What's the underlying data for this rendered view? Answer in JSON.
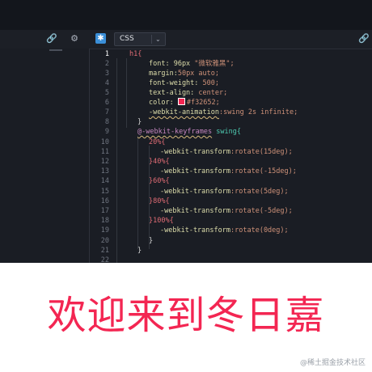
{
  "toolbar": {
    "link_icon": "link-icon",
    "settings_icon": "gear-icon",
    "app_icon": "snowflake-icon",
    "language": "CSS",
    "dropdown_icon": "chevron-down-icon",
    "right_icon": "link-icon",
    "app_glyph": "✱",
    "link_glyph": "🔗",
    "gear_glyph": "⚙",
    "chevron_glyph": "⌄"
  },
  "editor": {
    "line_numbers": [
      "1",
      "2",
      "3",
      "4",
      "5",
      "6",
      "7",
      "8",
      "9",
      "10",
      "11",
      "12",
      "13",
      "14",
      "15",
      "16",
      "17",
      "18",
      "19",
      "20",
      "21",
      "22"
    ],
    "active_line": "1",
    "lines": {
      "l1_sel": "h1{",
      "l2_prop": "font: 96px ",
      "l2_val": "\"微软雅黑\";",
      "l3_prop": "margin:",
      "l3_val": "50px auto;",
      "l4_prop": "font-weight: ",
      "l4_val": "500;",
      "l5_prop": "text-align: ",
      "l5_val": "center;",
      "l6_prop": "color: ",
      "l6_val": "#f32652;",
      "l7_prop": "-webkit-animation",
      "l7_val": ":swing 2s infinite;",
      "l8": "}",
      "l9_at": "@-webkit-keyframes",
      "l9_name": " swing{",
      "l10": "20%{",
      "l11_prop": "-webkit-transform",
      "l11_val": ":rotate(15deg);",
      "l12": "}40%{",
      "l13_prop": "-webkit-transform",
      "l13_val": ":rotate(-15deg);",
      "l14": "}60%{",
      "l15_prop": "-webkit-transform",
      "l15_val": ":rotate(5deg);",
      "l16": "}80%{",
      "l17_prop": "-webkit-transform",
      "l17_val": ":rotate(-5deg);",
      "l18": "}100%{",
      "l19_prop": "-webkit-transform",
      "l19_val": ":rotate(0deg);",
      "l20": "}",
      "l21": "}"
    },
    "swatch_color": "#f32652"
  },
  "preview": {
    "text": "欢迎来到冬日嘉",
    "color": "#f32652"
  },
  "watermark": {
    "text": "@稀土掘金技术社区"
  }
}
